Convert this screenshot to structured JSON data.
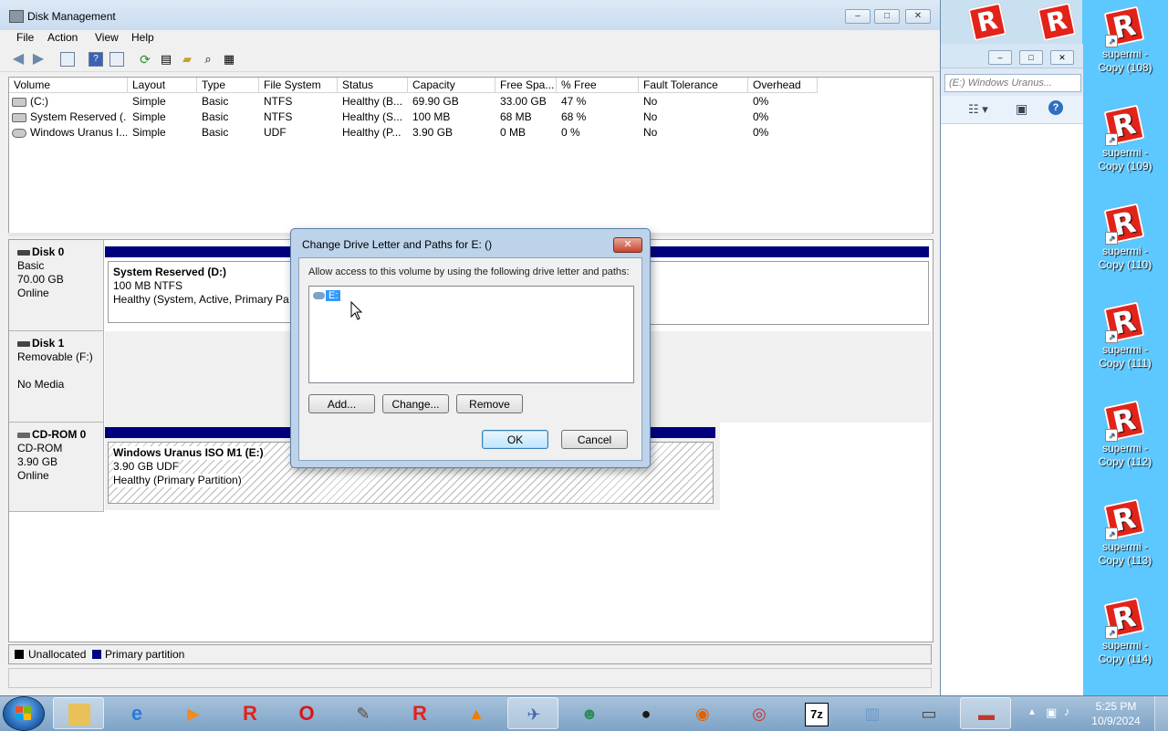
{
  "window": {
    "title": "Disk Management",
    "controls": {
      "minimize": "–",
      "maximize": "□",
      "close": "✕"
    }
  },
  "menu": [
    "File",
    "Action",
    "View",
    "Help"
  ],
  "volume_list": {
    "columns": [
      "Volume",
      "Layout",
      "Type",
      "File System",
      "Status",
      "Capacity",
      "Free Spa...",
      "% Free",
      "Fault Tolerance",
      "Overhead"
    ],
    "rows": [
      [
        "(C:)",
        "Simple",
        "Basic",
        "NTFS",
        "Healthy (B...",
        "69.90 GB",
        "33.00 GB",
        "47 %",
        "No",
        "0%"
      ],
      [
        "System Reserved (...",
        "Simple",
        "Basic",
        "NTFS",
        "Healthy (S...",
        "100 MB",
        "68 MB",
        "68 %",
        "No",
        "0%"
      ],
      [
        "Windows Uranus I...",
        "Simple",
        "Basic",
        "UDF",
        "Healthy (P...",
        "3.90 GB",
        "0 MB",
        "0 %",
        "No",
        "0%"
      ]
    ]
  },
  "disks": [
    {
      "name": "Disk 0",
      "type": "Basic",
      "size": "70.00 GB",
      "state": "Online"
    },
    {
      "name": "Disk 1",
      "type": "Removable (F:)",
      "size": "",
      "state": "No Media"
    },
    {
      "name": "CD-ROM 0",
      "type": "CD-ROM",
      "size": "3.90 GB",
      "state": "Online"
    }
  ],
  "partitions": {
    "system_reserved": {
      "name": "System Reserved  (D:)",
      "size": "100 MB NTFS",
      "status": "Healthy (System, Active, Primary Partit"
    },
    "cdrom": {
      "name": "Windows Uranus ISO M1  (E:)",
      "size": "3.90 GB UDF",
      "status": "Healthy (Primary Partition)"
    }
  },
  "legend": {
    "unallocated": "Unallocated",
    "primary": "Primary partition",
    "unallocated_color": "#000000",
    "primary_color": "#00007f"
  },
  "dialog": {
    "title": "Change Drive Letter and Paths for E: ()",
    "close": "✕",
    "description": "Allow access to this volume by using the following drive letter and paths:",
    "entries": [
      "E:"
    ],
    "add_label": "Add...",
    "change_label": "Change...",
    "remove_label": "Remove",
    "ok_label": "OK",
    "cancel_label": "Cancel"
  },
  "background_window": {
    "search_placeholder": "(E:) Windows Uranus..."
  },
  "desktop_icons": [
    {
      "line1": "supermi -",
      "line2": "Copy (108)"
    },
    {
      "line1": "supermi -",
      "line2": "Copy (109)"
    },
    {
      "line1": "supermi -",
      "line2": "Copy (110)"
    },
    {
      "line1": "supermi -",
      "line2": "Copy (111)"
    },
    {
      "line1": "supermi -",
      "line2": "Copy (112)"
    },
    {
      "line1": "supermi -",
      "line2": "Copy (113)"
    },
    {
      "line1": "supermi -",
      "line2": "Copy (114)"
    }
  ],
  "taskbar": {
    "time": "5:25 PM",
    "date": "10/9/2024",
    "items": [
      "explorer",
      "internet-explorer",
      "media-player",
      "roblox",
      "opera",
      "gimp",
      "roblox",
      "vlc",
      "pidgin",
      "messenger",
      "bird",
      "firefox",
      "chrome",
      "7zip",
      "image-viewer",
      "terminal",
      "toolbox"
    ],
    "seven_zip_label": "7z"
  },
  "colors": {
    "primary_partition": "#00007f",
    "selection": "#3399ff",
    "desktop": "#5cc8ff"
  }
}
